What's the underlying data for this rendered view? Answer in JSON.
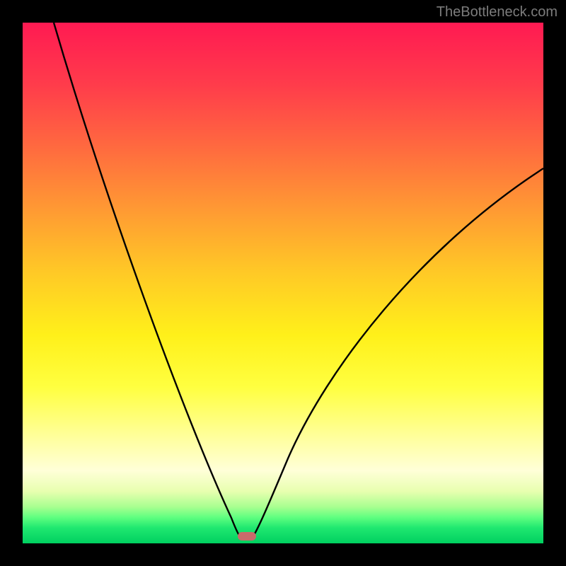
{
  "watermark": "TheBottleneck.com",
  "marker": {
    "cx_frac": 0.431,
    "cy_frac": 0.986
  },
  "chart_data": {
    "type": "line",
    "title": "",
    "xlabel": "",
    "ylabel": "",
    "xlim": [
      0,
      1
    ],
    "ylim": [
      0,
      1
    ],
    "series": [
      {
        "name": "left-curve",
        "x": [
          0.06,
          0.095,
          0.13,
          0.165,
          0.2,
          0.235,
          0.27,
          0.305,
          0.34,
          0.375,
          0.403,
          0.42
        ],
        "y": [
          1.0,
          0.88,
          0.77,
          0.66,
          0.555,
          0.455,
          0.36,
          0.27,
          0.185,
          0.105,
          0.04,
          0.01
        ]
      },
      {
        "name": "right-curve",
        "x": [
          0.44,
          0.46,
          0.485,
          0.515,
          0.555,
          0.605,
          0.665,
          0.735,
          0.815,
          0.905,
          1.0
        ],
        "y": [
          0.01,
          0.055,
          0.12,
          0.195,
          0.275,
          0.36,
          0.445,
          0.525,
          0.6,
          0.665,
          0.72
        ]
      }
    ],
    "gradient_stops": [
      {
        "pos": 0.0,
        "color": "#ff1a52"
      },
      {
        "pos": 0.5,
        "color": "#ffe623"
      },
      {
        "pos": 0.88,
        "color": "#ffffcc"
      },
      {
        "pos": 1.0,
        "color": "#00d060"
      }
    ]
  }
}
